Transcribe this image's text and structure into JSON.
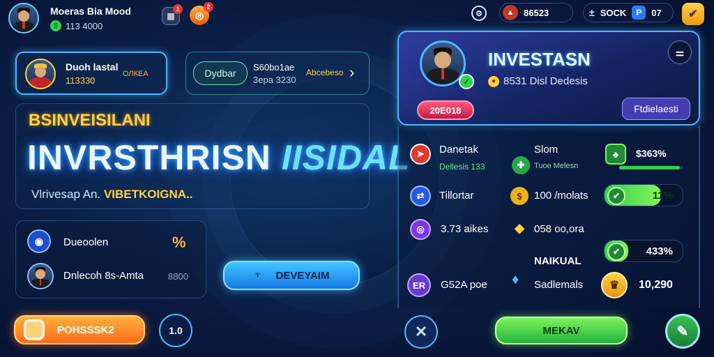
{
  "player": {
    "name": "Moeras Bia Mood",
    "currency": "113 4000"
  },
  "top_icons": {
    "notif_badge": "1",
    "gift_badge": "2"
  },
  "top_right": {
    "coins": "86523",
    "gems": "SOCK",
    "gems_tag": "P",
    "level": "07"
  },
  "left_cards": {
    "card1": {
      "title": "Duoh lastal",
      "value": "113330",
      "tag": "ОЛКЕА"
    },
    "card2": {
      "title": "Dydbar",
      "line1": "S60bo1ae",
      "line2": "3epa 3230",
      "tag": "Abcebeso"
    }
  },
  "hero": {
    "kicker": "BSINVEISILANI",
    "title_main": "INVRSTHRISN",
    "title_hl": "IISIDAL",
    "sub": "Vlrivesap An.",
    "sub_hl": "VIBETKOIGNA.."
  },
  "mini_list": {
    "row1": {
      "label": "Dueoolen",
      "value": "%"
    },
    "row2": {
      "label": "Dnlecoh 8s-Amta",
      "value": "8800"
    }
  },
  "buttons": {
    "develop": "DEVEYAIM",
    "progress": "POHSSSK2",
    "small": "1.0",
    "confirm": "MEKAV"
  },
  "profile": {
    "title": "INVESTASN",
    "subtitle": "8531 Disl Dedesis",
    "badge": "20E018",
    "action": "Ftdielaesti"
  },
  "stats": {
    "r1": {
      "left": "Danetak",
      "left_sub": "Dellesis 133",
      "mid": "Slom",
      "mid_sub": "Tuoe Melesn",
      "bar": "$363%",
      "bar_fill": 0.95
    },
    "r2": {
      "left": "Tillortar",
      "mid": "100 /molats",
      "bar": "11%",
      "bar_fill": 0.72
    },
    "r3": {
      "left": "3.73 aikes",
      "mid": "058 oo,ora",
      "bar": "433%",
      "bar_fill": 0.3
    },
    "heading": "NAIKUAL",
    "r4": {
      "left_icon": "ER",
      "left": "G52A poe",
      "mid": "Sadlemals",
      "value": "10,290"
    }
  },
  "colors": {
    "accent_blue": "#4db8ff",
    "gold": "#ffd23f",
    "green": "#2fd14e",
    "orange": "#ff6a1a"
  }
}
